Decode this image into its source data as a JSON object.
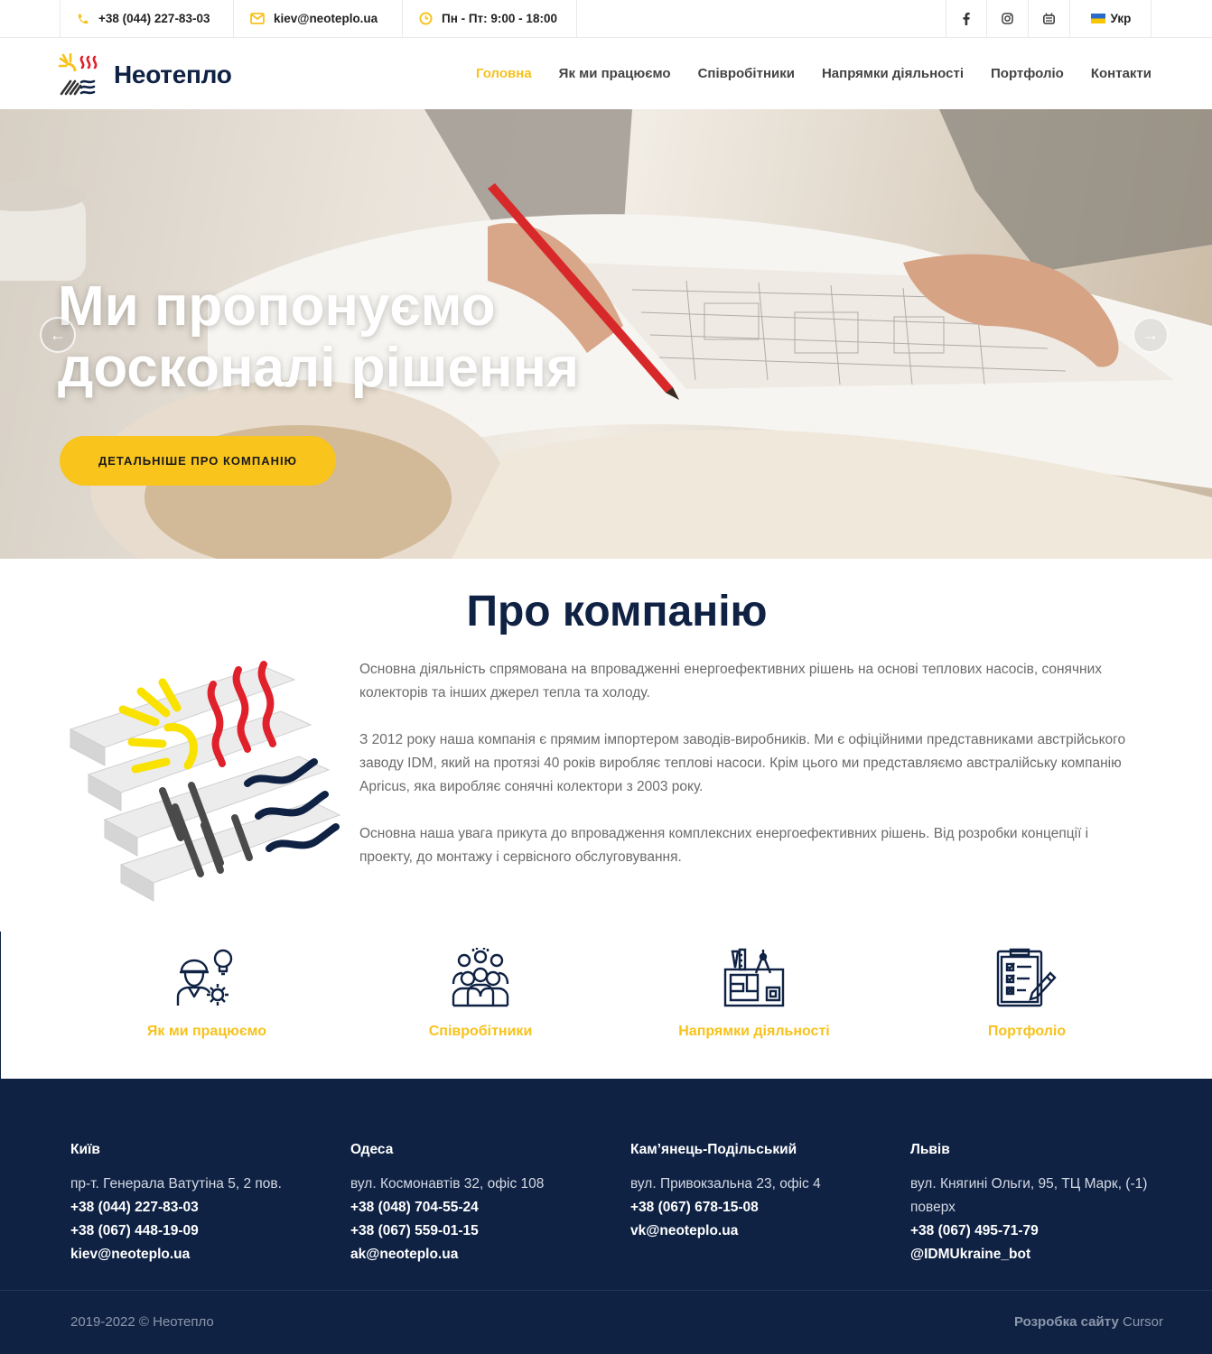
{
  "topbar": {
    "phone": "+38 (044) 227-83-03",
    "email": "kiev@neoteplo.ua",
    "hours": "Пн - Пт: 9:00 - 18:00",
    "social": [
      "facebook-icon",
      "instagram-icon",
      "youtube-icon"
    ],
    "language": "Укр"
  },
  "header": {
    "logo_text": "Неотепло",
    "nav": [
      "Головна",
      "Як ми працюємо",
      "Співробітники",
      "Напрямки діяльності",
      "Портфоліо",
      "Контакти"
    ]
  },
  "hero": {
    "title": "Ми пропонуємо досконалі рішення",
    "button": "ДЕТАЛЬНІШЕ ПРО КОМПАНІЮ",
    "prev_icon": "←",
    "next_icon": "→"
  },
  "about": {
    "title": "Про компанію",
    "paragraphs": [
      "Основна діяльність спрямована на впровадженні енергоефективних рішень на основі теплових насосів, сонячних колекторів та інших джерел тепла та холоду.",
      "З 2012 року наша компанія є прямим імпортером заводів-виробників. Ми є офіційними представниками австрійського заводу IDM, який на протязі 40 років виробляє теплові насоси. Крім цього ми представляємо австралійську компанію Apricus, яка виробляє сонячні колектори з 2003 року.",
      "Основна наша увага прикута до впровадження комплексних енергоефективних рішень. Від розробки концепції і проекту, до монтажу і сервісного обслуговування."
    ]
  },
  "features": [
    {
      "label": "Як ми працюємо",
      "icon": "worker-idea-icon"
    },
    {
      "label": "Співробітники",
      "icon": "team-icon"
    },
    {
      "label": "Напрямки діяльності",
      "icon": "blueprint-tools-icon"
    },
    {
      "label": "Портфоліо",
      "icon": "checklist-icon"
    }
  ],
  "footer": {
    "offices": [
      {
        "city": "Київ",
        "address": "пр-т. Генерала Ватутіна 5, 2 пов.",
        "contacts": [
          "+38 (044) 227-83-03",
          "+38 (067) 448-19-09",
          "kiev@neoteplo.ua"
        ]
      },
      {
        "city": "Одеса",
        "address": "вул. Космонавтів 32, офіс 108",
        "contacts": [
          "+38 (048) 704-55-24",
          "+38 (067) 559-01-15",
          "ak@neoteplo.ua"
        ]
      },
      {
        "city": "Кам’янець-Подільський",
        "address": "вул. Привокзальна 23, офіс 4",
        "contacts": [
          "+38 (067) 678-15-08",
          "vk@neoteplo.ua"
        ]
      },
      {
        "city": "Львів",
        "address": "вул. Княгині Ольги, 95, ТЦ Марк, (-1) поверх",
        "contacts": [
          "+38 (067) 495-71-79",
          "@IDMUkraine_bot"
        ]
      }
    ],
    "copyright": "2019-2022 © Неотепло",
    "credit_label": "Розробка сайту",
    "credit_name": "Cursor"
  },
  "colors": {
    "accent": "#f7c21b",
    "navy": "#0f2244",
    "red": "#e0202a"
  }
}
